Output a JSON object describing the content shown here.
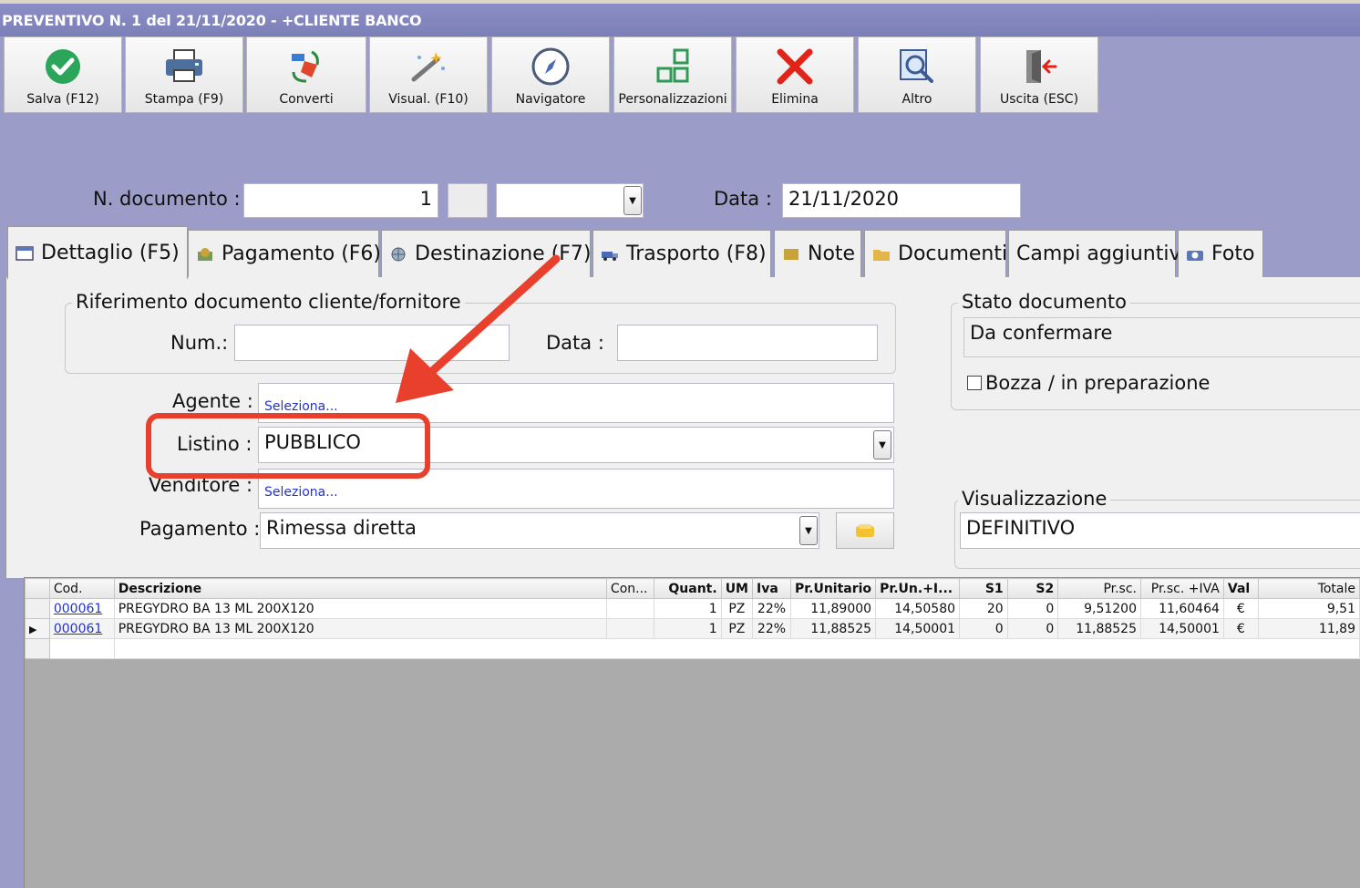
{
  "window": {
    "title": "PREVENTIVO N. 1 del 21/11/2020 - +CLIENTE BANCO"
  },
  "toolbar": {
    "buttons": [
      {
        "label": "Salva (F12)",
        "icon": "check-circle-icon"
      },
      {
        "label": "Stampa (F9)",
        "icon": "printer-icon"
      },
      {
        "label": "Converti",
        "icon": "convert-icon"
      },
      {
        "label": "Visual. (F10)",
        "icon": "magic-wand-icon"
      },
      {
        "label": "Navigatore",
        "icon": "compass-icon"
      },
      {
        "label": "Personalizzazioni",
        "icon": "grid-blocks-icon"
      },
      {
        "label": "Elimina",
        "icon": "red-x-icon"
      },
      {
        "label": "Altro",
        "icon": "magnifier-icon"
      },
      {
        "label": "Uscita (ESC)",
        "icon": "exit-door-icon"
      }
    ]
  },
  "header": {
    "doc_number_label": "N. documento :",
    "doc_number_value": "1",
    "date_label": "Data :",
    "date_value": "21/11/2020"
  },
  "tabs": [
    {
      "label": "Dettaglio (F5)",
      "active": true
    },
    {
      "label": "Pagamento (F6)"
    },
    {
      "label": "Destinazione (F7)"
    },
    {
      "label": "Trasporto (F8)"
    },
    {
      "label": "Note"
    },
    {
      "label": "Documenti"
    },
    {
      "label": "Campi aggiuntivi"
    },
    {
      "label": "Foto"
    }
  ],
  "riferimento": {
    "legend": "Riferimento documento cliente/fornitore",
    "num_label": "Num.:",
    "num_value": "",
    "data_label": "Data :",
    "data_value": ""
  },
  "form": {
    "agente_label": "Agente :",
    "agente_value": "Seleziona...",
    "listino_label": "Listino :",
    "listino_value": "PUBBLICO",
    "venditore_label": "Venditore :",
    "venditore_value": "Seleziona...",
    "pagamento_label": "Pagamento :",
    "pagamento_value": "Rimessa diretta"
  },
  "stato": {
    "legend": "Stato documento",
    "value": "Da confermare",
    "bozza_label": "Bozza / in preparazione",
    "bozza_checked": false
  },
  "visualizzazione": {
    "legend": "Visualizzazione",
    "value": "DEFINITIVO"
  },
  "grid": {
    "columns": [
      "Cod.",
      "Descrizione",
      "Con...",
      "Quant.",
      "UM",
      "Iva",
      "Pr.Unitario",
      "Pr.Un.+I...",
      "S1",
      "S2",
      "Pr.sc.",
      "Pr.sc. +IVA",
      "Val",
      "Totale"
    ],
    "rows": [
      [
        "000061",
        "PREGYDRO BA 13 ML 200X120",
        "",
        "1",
        "PZ",
        "22%",
        "11,89000",
        "14,50580",
        "20",
        "0",
        "9,51200",
        "11,60464",
        "€",
        "9,51"
      ],
      [
        "000061",
        "PREGYDRO BA 13 ML 200X120",
        "",
        "1",
        "PZ",
        "22%",
        "11,88525",
        "14,50001",
        "0",
        "0",
        "11,88525",
        "14,50001",
        "€",
        "11,89"
      ]
    ]
  },
  "colors": {
    "background": "#9c9cc8",
    "annotation": "#e8402c",
    "link": "#2233cc"
  }
}
